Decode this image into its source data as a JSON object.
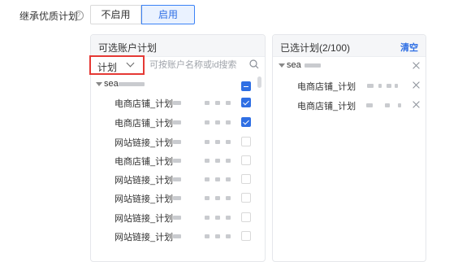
{
  "inherit": {
    "label": "继承优质计划",
    "help_icon": "question-circle-icon",
    "options": [
      "不启用",
      "启用"
    ],
    "selected": "启用"
  },
  "available": {
    "title": "可选账户计划",
    "type_select": "计划",
    "search_placeholder": "可按账户名称或id搜索",
    "group_label": "sea",
    "rows": [
      {
        "label": "电商店铺_计划",
        "checked": true
      },
      {
        "label": "电商店铺_计划",
        "checked": true
      },
      {
        "label": "网站链接_计划",
        "checked": false
      },
      {
        "label": "电商店铺_计划",
        "checked": false
      },
      {
        "label": "网站链接_计划",
        "checked": false
      },
      {
        "label": "网站链接_计划",
        "checked": false
      },
      {
        "label": "网站链接_计划",
        "checked": false
      },
      {
        "label": "网站链接_计划",
        "checked": false
      }
    ]
  },
  "selected": {
    "title": "已选计划(2/100)",
    "clear_label": "清空",
    "group_label": "sea",
    "items": [
      {
        "label": "电商店铺_计划"
      },
      {
        "label": "电商店铺_计划"
      }
    ]
  },
  "colors": {
    "accent": "#2f6fe4",
    "highlight_border": "#e53935"
  }
}
